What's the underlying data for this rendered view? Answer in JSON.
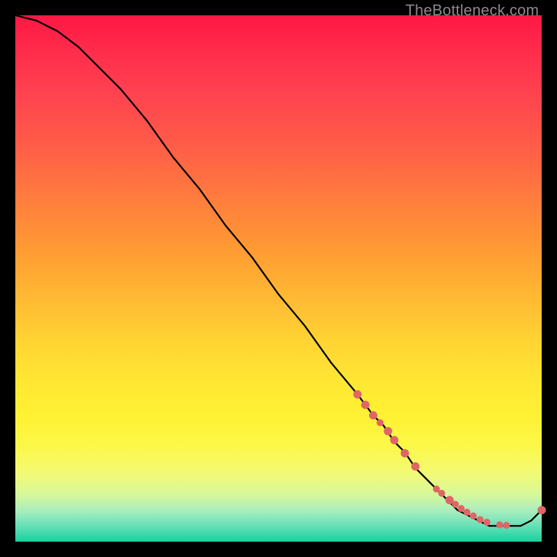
{
  "watermark": "TheBottleneck.com",
  "chart_data": {
    "type": "line",
    "title": "",
    "xlabel": "",
    "ylabel": "",
    "xlim": [
      0,
      100
    ],
    "ylim": [
      0,
      100
    ],
    "grid": false,
    "legend": false,
    "series": [
      {
        "name": "bottleneck-curve",
        "color": "#000000",
        "x": [
          0,
          4,
          8,
          12,
          16,
          20,
          25,
          30,
          35,
          40,
          45,
          50,
          55,
          60,
          65,
          68,
          70,
          72,
          74,
          76,
          78,
          80,
          82,
          84,
          86,
          88,
          90,
          92,
          94,
          96,
          98,
          100
        ],
        "y": [
          100,
          99,
          97,
          94,
          90,
          86,
          80,
          73,
          67,
          60,
          54,
          47,
          41,
          34,
          28,
          24,
          22,
          19,
          17,
          14,
          12,
          10,
          8,
          6,
          5,
          4,
          3,
          3,
          3,
          3,
          4,
          6
        ]
      }
    ],
    "markers": {
      "name": "highlight-points",
      "color": "#e06666",
      "radius_sequence": [
        6,
        6,
        6,
        5,
        6,
        6,
        6,
        6,
        5,
        5,
        6,
        5,
        5,
        5,
        5,
        5,
        5,
        5,
        5,
        6
      ],
      "x": [
        65.0,
        66.5,
        68.0,
        69.3,
        70.8,
        72.0,
        74.0,
        76.0,
        80.0,
        81.0,
        82.5,
        83.6,
        84.7,
        85.8,
        87.0,
        88.3,
        89.6,
        92.0,
        93.3,
        100.0
      ],
      "y": [
        28.0,
        26.0,
        24.0,
        22.6,
        21.0,
        19.3,
        16.8,
        14.3,
        10.0,
        9.2,
        7.9,
        7.1,
        6.3,
        5.6,
        4.9,
        4.2,
        3.7,
        3.2,
        3.1,
        6.0
      ]
    }
  }
}
